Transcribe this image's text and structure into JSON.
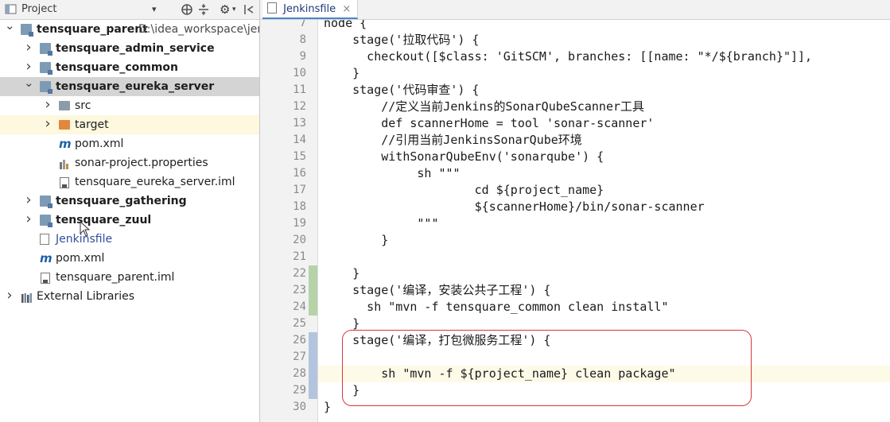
{
  "project_panel": {
    "toolbar": {
      "title": "Project",
      "dropdown_glyph": "▾",
      "settings_glyph": "⚙",
      "icons": [
        "target-icon",
        "collapse-icon",
        "gear-icon",
        "hide-icon"
      ]
    },
    "tree": [
      {
        "label": "tensquare_parent",
        "path": "D:\\idea_workspace\\jenk",
        "indent": 0,
        "arrow": "expanded",
        "icon": "module",
        "bold": true
      },
      {
        "label": "tensquare_admin_service",
        "indent": 1,
        "arrow": "collapsed",
        "icon": "module",
        "bold": true
      },
      {
        "label": "tensquare_common",
        "indent": 1,
        "arrow": "collapsed",
        "icon": "module",
        "bold": true
      },
      {
        "label": "tensquare_eureka_server",
        "indent": 1,
        "arrow": "expanded",
        "icon": "module",
        "bold": true,
        "selected": true
      },
      {
        "label": "src",
        "indent": 2,
        "arrow": "collapsed",
        "icon": "folder"
      },
      {
        "label": "target",
        "indent": 2,
        "arrow": "collapsed",
        "icon": "folder-orange",
        "highlight": true
      },
      {
        "label": "pom.xml",
        "indent": 2,
        "icon": "maven"
      },
      {
        "label": "sonar-project.properties",
        "indent": 2,
        "icon": "properties"
      },
      {
        "label": "tensquare_eureka_server.iml",
        "indent": 2,
        "icon": "iml"
      },
      {
        "label": "tensquare_gathering",
        "indent": 1,
        "arrow": "collapsed",
        "icon": "module",
        "bold": true
      },
      {
        "label": "tensquare_zuul",
        "indent": 1,
        "arrow": "collapsed",
        "icon": "module",
        "bold": true
      },
      {
        "label": "Jenkinsfile",
        "indent": 1,
        "icon": "file",
        "color": "#2f4f9a"
      },
      {
        "label": "pom.xml",
        "indent": 1,
        "icon": "maven"
      },
      {
        "label": "tensquare_parent.iml",
        "indent": 1,
        "icon": "iml"
      },
      {
        "label": "External Libraries",
        "indent": 0,
        "arrow": "collapsed",
        "icon": "libraries"
      }
    ]
  },
  "editor": {
    "tab": {
      "label": "Jenkinsfile",
      "close": "×"
    },
    "lines": [
      {
        "n": "7",
        "text": "node {"
      },
      {
        "n": "8",
        "text": "    stage('拉取代码') {"
      },
      {
        "n": "9",
        "text": "      checkout([$class: 'GitSCM', branches: [[name: \"*/${branch}\"]],"
      },
      {
        "n": "10",
        "text": "    }"
      },
      {
        "n": "11",
        "text": "    stage('代码审查') {"
      },
      {
        "n": "12",
        "text": "        //定义当前Jenkins的SonarQubeScanner工具"
      },
      {
        "n": "13",
        "text": "        def scannerHome = tool 'sonar-scanner'"
      },
      {
        "n": "14",
        "text": "        //引用当前JenkinsSonarQube环境"
      },
      {
        "n": "15",
        "text": "        withSonarQubeEnv('sonarqube') {"
      },
      {
        "n": "16",
        "text": "             sh \"\"\""
      },
      {
        "n": "17",
        "text": "                     cd ${project_name}"
      },
      {
        "n": "18",
        "text": "                     ${scannerHome}/bin/sonar-scanner"
      },
      {
        "n": "19",
        "text": "             \"\"\""
      },
      {
        "n": "20",
        "text": "        }"
      },
      {
        "n": "21",
        "text": ""
      },
      {
        "n": "22",
        "text": "    }"
      },
      {
        "n": "23",
        "text": "    stage('编译，安装公共子工程') {"
      },
      {
        "n": "24",
        "text": "      sh \"mvn -f tensquare_common clean install\""
      },
      {
        "n": "25",
        "text": "    }"
      },
      {
        "n": "26",
        "text": "    stage('编译，打包微服务工程') {"
      },
      {
        "n": "27",
        "text": ""
      },
      {
        "n": "28",
        "text": "        sh \"mvn -f ${project_name} clean package\"",
        "current": true
      },
      {
        "n": "29",
        "text": "    }"
      },
      {
        "n": "30",
        "text": "}"
      }
    ],
    "change_markers": [
      {
        "from_line": "22",
        "to_line": "24",
        "kind": "added",
        "color": "#b6d3a8"
      },
      {
        "from_line": "26",
        "to_line": "29",
        "kind": "modified",
        "color": "#b3c5de"
      }
    ],
    "annotation": {
      "kind": "highlight-box",
      "color": "#d9363e",
      "covers_lines": [
        "26",
        "29"
      ]
    }
  }
}
